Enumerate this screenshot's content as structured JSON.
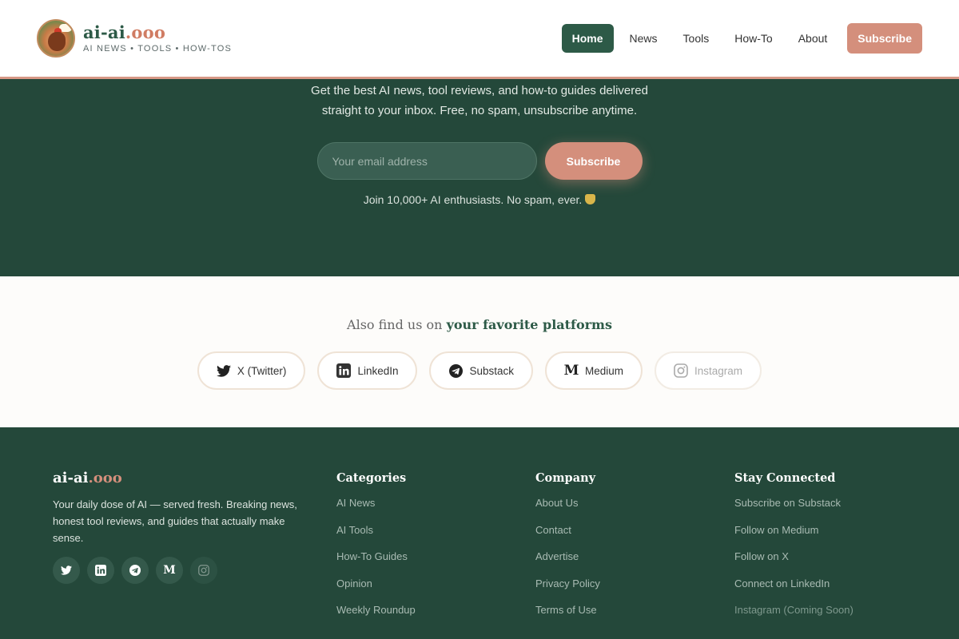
{
  "header": {
    "logo_title_main": "ai-ai",
    "logo_title_accent": ".ooo",
    "logo_subtitle": "AI NEWS • TOOLS • HOW-TOS",
    "nav": [
      {
        "label": "Home",
        "active": true
      },
      {
        "label": "News"
      },
      {
        "label": "Tools"
      },
      {
        "label": "How-To"
      },
      {
        "label": "About"
      }
    ],
    "subscribe_label": "Subscribe"
  },
  "hero": {
    "description_line1": "Get the best AI news, tool reviews, and how-to guides delivered",
    "description_line2": "straight to your inbox. Free, no spam, unsubscribe anytime.",
    "email_placeholder": "Your email address",
    "subscribe_label": "Subscribe",
    "note": "Join 10,000+ AI enthusiasts. No spam, ever."
  },
  "platforms": {
    "title_prefix": "Also find us on",
    "title_bold": "your favorite platforms",
    "items": [
      {
        "label": "X (Twitter)",
        "icon": "twitter-icon"
      },
      {
        "label": "LinkedIn",
        "icon": "linkedin-icon"
      },
      {
        "label": "Substack",
        "icon": "telegram-icon"
      },
      {
        "label": "Medium",
        "icon": "medium-icon"
      },
      {
        "label": "Instagram",
        "icon": "instagram-icon",
        "disabled": true
      }
    ]
  },
  "footer": {
    "brand_main": "ai-ai",
    "brand_accent": ".ooo",
    "description": "Your daily dose of AI — served fresh. Breaking news, honest tool reviews, and guides that actually make sense.",
    "columns": [
      {
        "title": "Categories",
        "links": [
          "AI News",
          "AI Tools",
          "How-To Guides",
          "Opinion",
          "Weekly Roundup"
        ]
      },
      {
        "title": "Company",
        "links": [
          "About Us",
          "Contact",
          "Advertise",
          "Privacy Policy",
          "Terms of Use"
        ]
      },
      {
        "title": "Stay Connected",
        "links": [
          "Subscribe on Substack",
          "Follow on Medium",
          "Follow on X",
          "Connect on LinkedIn",
          "Instagram (Coming Soon)"
        ]
      }
    ]
  },
  "colors": {
    "primary_green": "#2d5a47",
    "dark_green": "#24483a",
    "accent_salmon": "#d48f7c"
  }
}
